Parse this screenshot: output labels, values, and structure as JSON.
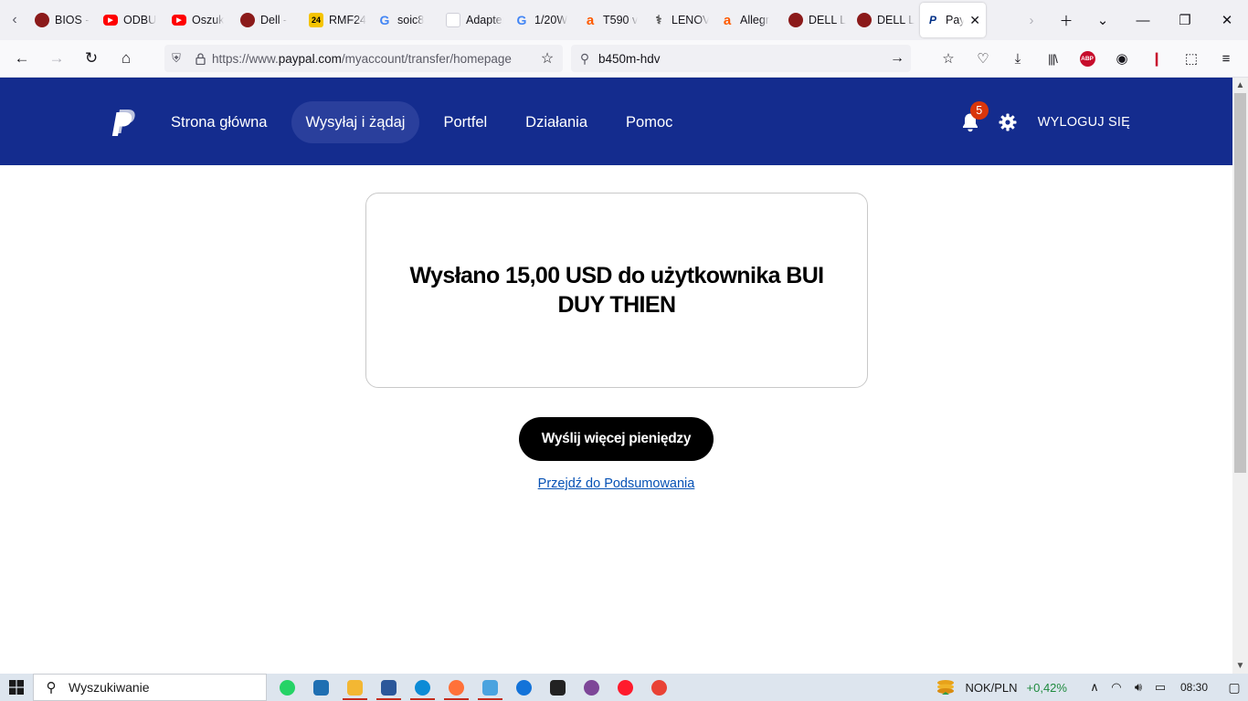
{
  "browser": {
    "tabs": [
      {
        "label": "BIOS -",
        "icon": "dell-icon",
        "color": "#8b1a1a"
      },
      {
        "label": "ODBU",
        "icon": "youtube-icon",
        "color": "#ff0000"
      },
      {
        "label": "Oszuk",
        "icon": "youtube-icon",
        "color": "#ff0000"
      },
      {
        "label": "Dell -",
        "icon": "dell-icon",
        "color": "#8b1a1a"
      },
      {
        "label": "RMF24",
        "icon": "rmf24-icon",
        "color": "#f5c400"
      },
      {
        "label": "soic8",
        "icon": "google-icon",
        "color": "#4285f4"
      },
      {
        "label": "Adapter ig",
        "icon": "blank-page-icon",
        "color": "#ffffff"
      },
      {
        "label": "1/20W",
        "icon": "google-icon",
        "color": "#4285f4"
      },
      {
        "label": "T590 v",
        "icon": "allegro-icon",
        "color": "#ff5a00"
      },
      {
        "label": "LENOV",
        "icon": "lenovo-icon",
        "color": "#555555"
      },
      {
        "label": "Allegr",
        "icon": "allegro-icon",
        "color": "#ff5a00"
      },
      {
        "label": "DELL L",
        "icon": "dell-icon",
        "color": "#8b1a1a"
      },
      {
        "label": "DELL L",
        "icon": "dell-icon",
        "color": "#8b1a1a"
      },
      {
        "label": "Pay",
        "icon": "paypal-icon",
        "color": "#003087"
      }
    ],
    "url": {
      "prefix": "https://www.",
      "host": "paypal.com",
      "path": "/myaccount/transfer/homepage"
    },
    "search_value": "b450m-hdv",
    "abp_label": "ABP"
  },
  "paypal": {
    "nav": [
      {
        "label": "Strona główna",
        "active": false
      },
      {
        "label": "Wysyłaj i żądaj",
        "active": true
      },
      {
        "label": "Portfel",
        "active": false
      },
      {
        "label": "Działania",
        "active": false
      },
      {
        "label": "Pomoc",
        "active": false
      }
    ],
    "notification_count": "5",
    "logout_label": "WYLOGUJ SIĘ",
    "result_title": "Wysłano 15,00 USD do użytkownika BUI DUY THIEN",
    "send_more_label": "Wyślij więcej pieniędzy",
    "summary_link_label": "Przejdź do Podsumowania",
    "colors": {
      "header": "#142c8e",
      "active_nav": "#2a3f9c",
      "badge": "#d9360b",
      "link": "#0551b5"
    }
  },
  "taskbar": {
    "search_placeholder": "Wyszukiwanie",
    "apps": [
      {
        "name": "whatsapp-icon",
        "color": "#25d366",
        "running": false
      },
      {
        "name": "news-app-icon",
        "color": "#1f6fb2",
        "running": false
      },
      {
        "name": "file-explorer-icon",
        "color": "#f3b733",
        "running": true
      },
      {
        "name": "word-icon",
        "color": "#2b579a",
        "running": true
      },
      {
        "name": "edge-icon",
        "color": "#0c8bd6",
        "running": true
      },
      {
        "name": "firefox-icon",
        "color": "#ff7139",
        "running": true
      },
      {
        "name": "notepad-icon",
        "color": "#4aa3df",
        "running": true
      },
      {
        "name": "thunderbird-icon",
        "color": "#1373d9",
        "running": false
      },
      {
        "name": "cube-app-icon",
        "color": "#222222",
        "running": false
      },
      {
        "name": "tor-browser-icon",
        "color": "#7d4698",
        "running": false
      },
      {
        "name": "opera-icon",
        "color": "#ff1b2d",
        "running": false
      },
      {
        "name": "chrome-icon",
        "color": "#e94235",
        "running": false
      }
    ],
    "ticker_name": "NOK/PLN",
    "ticker_change": "+0,42%",
    "time": "08:30"
  }
}
